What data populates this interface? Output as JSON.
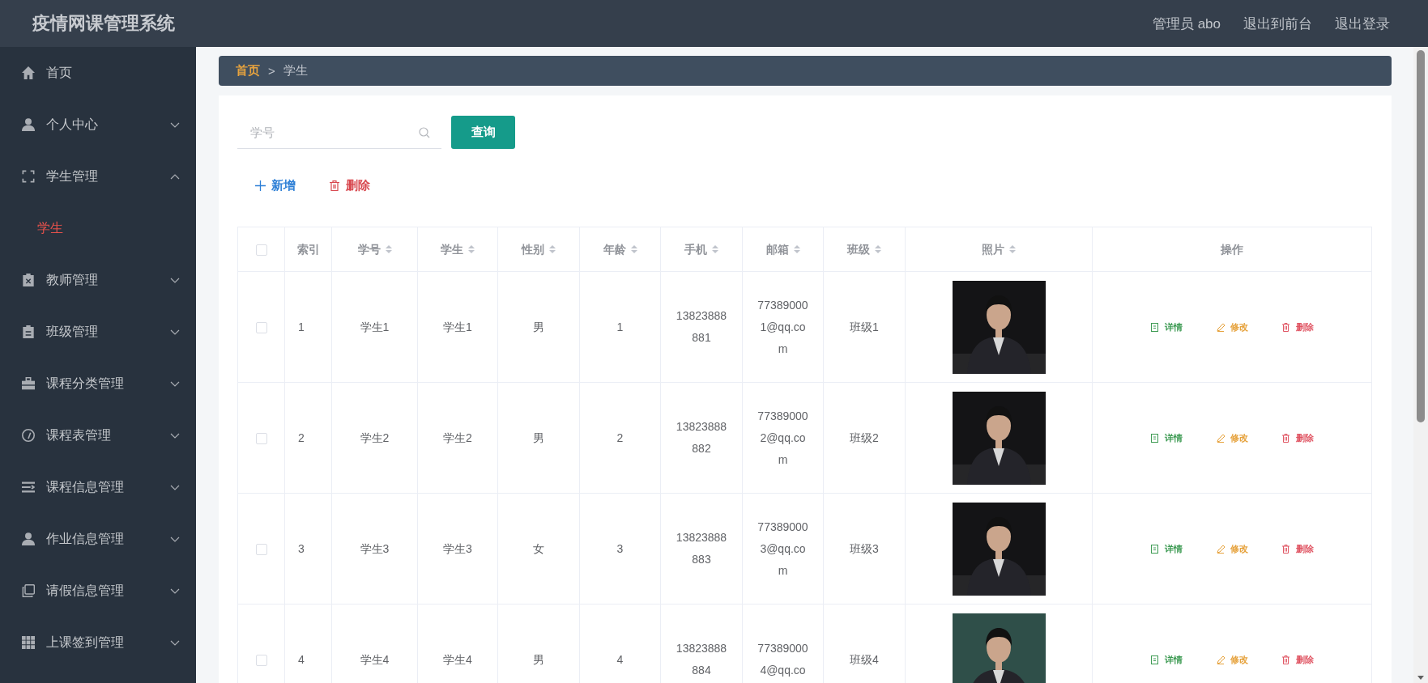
{
  "header": {
    "title": "疫情网课管理系统",
    "links": [
      "管理员 abo",
      "退出到前台",
      "退出登录"
    ]
  },
  "sidebar": {
    "items": [
      {
        "label": "首页",
        "selected": false
      },
      {
        "label": "个人中心",
        "selected": false,
        "expanded": false
      },
      {
        "label": "学生管理",
        "selected": false,
        "expanded": true,
        "children": [
          {
            "label": "学生",
            "selected": true
          }
        ]
      },
      {
        "label": "教师管理",
        "selected": false,
        "expanded": false
      },
      {
        "label": "班级管理",
        "selected": false,
        "expanded": false
      },
      {
        "label": "课程分类管理",
        "selected": false,
        "expanded": false
      },
      {
        "label": "课程表管理",
        "selected": false,
        "expanded": false
      },
      {
        "label": "课程信息管理",
        "selected": false,
        "expanded": false
      },
      {
        "label": "作业信息管理",
        "selected": false,
        "expanded": false
      },
      {
        "label": "请假信息管理",
        "selected": false,
        "expanded": false
      },
      {
        "label": "上课签到管理",
        "selected": false,
        "expanded": false
      }
    ]
  },
  "breadcrumb": {
    "items": [
      "首页",
      "学生"
    ],
    "separator": ">"
  },
  "search": {
    "placeholder": "学号",
    "button": "查询"
  },
  "toolbar": [
    {
      "kind": "add",
      "label": "新增"
    },
    {
      "kind": "delete",
      "label": "删除"
    }
  ],
  "table": {
    "select_all_checked": false,
    "columns": [
      {
        "label": "索引",
        "sortable": false
      },
      {
        "label": "学号",
        "sortable": true
      },
      {
        "label": "学生",
        "sortable": true
      },
      {
        "label": "性别",
        "sortable": true
      },
      {
        "label": "年龄",
        "sortable": true
      },
      {
        "label": "手机",
        "sortable": true
      },
      {
        "label": "邮箱",
        "sortable": true
      },
      {
        "label": "班级",
        "sortable": true
      },
      {
        "label": "照片",
        "sortable": true
      },
      {
        "label": "操作",
        "sortable": false
      }
    ],
    "rows": [
      {
        "checked": false,
        "cells": [
          "1",
          "学生1",
          "学生1",
          "男",
          "1",
          "13823888881",
          "773890001@qq.com",
          "班级1"
        ],
        "photo": {
          "kind": "picture",
          "color": "#141416"
        },
        "actions": [
          {
            "kind": "view",
            "label": "详情"
          },
          {
            "kind": "edit",
            "label": "修改"
          },
          {
            "kind": "delete",
            "label": "删除"
          }
        ]
      },
      {
        "checked": false,
        "cells": [
          "2",
          "学生2",
          "学生2",
          "男",
          "2",
          "13823888882",
          "773890002@qq.com",
          "班级2"
        ],
        "photo": {
          "kind": "picture",
          "color": "#141416"
        },
        "actions": [
          {
            "kind": "view",
            "label": "详情"
          },
          {
            "kind": "edit",
            "label": "修改"
          },
          {
            "kind": "delete",
            "label": "删除"
          }
        ]
      },
      {
        "checked": false,
        "cells": [
          "3",
          "学生3",
          "学生3",
          "女",
          "3",
          "13823888883",
          "773890003@qq.com",
          "班级3"
        ],
        "photo": {
          "kind": "picture",
          "color": "#141416"
        },
        "actions": [
          {
            "kind": "view",
            "label": "详情"
          },
          {
            "kind": "edit",
            "label": "修改"
          },
          {
            "kind": "delete",
            "label": "删除"
          }
        ]
      },
      {
        "checked": false,
        "cells": [
          "4",
          "学生4",
          "学生4",
          "男",
          "4",
          "13823888884",
          "773890004@qq.co",
          "班级4"
        ],
        "photo": {
          "kind": "picture",
          "color": "#2f4f49"
        },
        "actions": [
          {
            "kind": "view",
            "label": "详情"
          },
          {
            "kind": "edit",
            "label": "修改"
          },
          {
            "kind": "delete",
            "label": "删除"
          }
        ]
      }
    ]
  }
}
